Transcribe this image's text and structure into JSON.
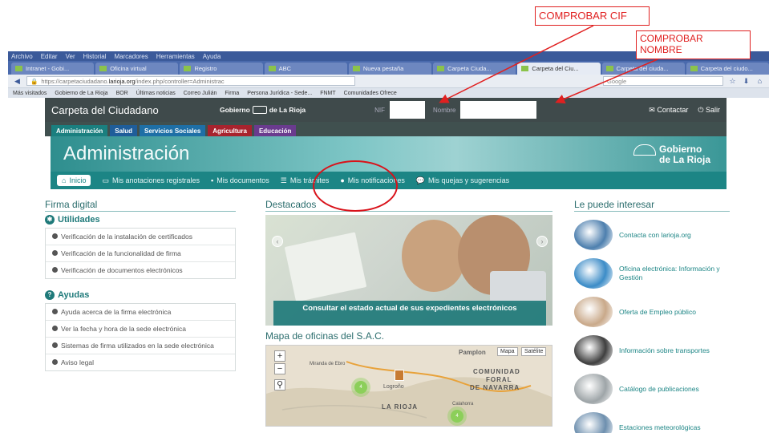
{
  "annotations": {
    "cif": "COMPROBAR CIF",
    "nombre_line1": "COMPROBAR",
    "nombre_line2": "NOMBRE"
  },
  "browser": {
    "menu": [
      "Archivo",
      "Editar",
      "Ver",
      "Historial",
      "Marcadores",
      "Herramientas",
      "Ayuda"
    ],
    "tabs": [
      {
        "label": "Intranet - Gobi..."
      },
      {
        "label": "Oficina virtual"
      },
      {
        "label": "Registro"
      },
      {
        "label": "ABC"
      },
      {
        "label": "Nueva pestaña"
      },
      {
        "label": "Carpeta Ciuda..."
      },
      {
        "label": "Carpeta del Ciu...",
        "active": true
      },
      {
        "label": "Carpeta del ciuda..."
      },
      {
        "label": "Carpeta del ciudo..."
      }
    ],
    "url_prefix": "https://carpetaciudadano.",
    "url_domain": "larioja.org",
    "url_suffix": "/index.php/controller=Administrac",
    "search_placeholder": "Google",
    "bookmarks": [
      "Más visitados",
      "Gobierno de La Rioja",
      "BOR",
      "Últimas noticias",
      "Correo Julián",
      "Firma",
      "Persona Jurídica - Sede...",
      "FNMT",
      "Comunidades Ofrece"
    ]
  },
  "site": {
    "name": "Carpeta del Ciudadano",
    "gov_brand_left": "Gobierno",
    "gov_brand_right": "de La Rioja",
    "nif_label": "NIF",
    "nombre_label": "Nombre",
    "contact": "Contactar",
    "logout": "Salir",
    "sections": [
      {
        "label": "Administración",
        "color": "#1a7f7f"
      },
      {
        "label": "Salud",
        "color": "#1f5d9a"
      },
      {
        "label": "Servicios Sociales",
        "color": "#1e6fa6"
      },
      {
        "label": "Agricultura",
        "color": "#a8232e"
      },
      {
        "label": "Educación",
        "color": "#6a3b8e"
      }
    ],
    "banner_title": "Administración",
    "banner_gov_line1": "Gobierno",
    "banner_gov_line2": "de La Rioja",
    "nav": [
      {
        "label": "Inicio",
        "icon": "home-icon"
      },
      {
        "label": "Mis anotaciones registrales",
        "icon": "laptop-icon"
      },
      {
        "label": "Mis documentos",
        "icon": "folder-icon"
      },
      {
        "label": "Mis trámites",
        "icon": "list-icon"
      },
      {
        "label": "Mis notificaciones",
        "icon": "alert-icon"
      },
      {
        "label": "Mis quejas y sugerencias",
        "icon": "chat-icon"
      }
    ]
  },
  "left": {
    "title": "Firma digital",
    "utilidades_title": "Utilidades",
    "utilidades": [
      "Verificación de la instalación de certificados",
      "Verificación de la funcionalidad de firma",
      "Verificación de documentos electrónicos"
    ],
    "ayudas_title": "Ayudas",
    "ayudas": [
      "Ayuda acerca de la firma electrónica",
      "Ver la fecha y hora de la sede electrónica",
      "Sistemas de firma utilizados en la sede electrónica",
      "Aviso legal"
    ]
  },
  "center": {
    "title": "Destacados",
    "caption": "Consultar el estado actual de sus expedientes electrónicos",
    "map_title": "Mapa de oficinas del S.A.C.",
    "map_buttons": [
      "Mapa",
      "Satélite"
    ],
    "map_labels": [
      "Pamplon",
      "COMUNIDAD",
      "FORAL",
      "DE NAVARRA",
      "LA RIOJA",
      "Logroño",
      "Miranda de Ebro",
      "Calahorra"
    ],
    "clusters": [
      "4",
      "4"
    ]
  },
  "right": {
    "title": "Le puede interesar",
    "items": [
      {
        "label": "Contacta con larioja.org",
        "color": "#4d7fae"
      },
      {
        "label": "Oficina electrónica: Información y Gestión",
        "color": "#3c8cc7"
      },
      {
        "label": "Oferta de Empleo público",
        "color": "#c9a98a"
      },
      {
        "label": "Información sobre transportes",
        "color": "#3f3f3f"
      },
      {
        "label": "Catálogo de publicaciones",
        "color": "#9ea5a8"
      },
      {
        "label": "Estaciones meteorológicas",
        "color": "#6d8fae"
      }
    ]
  }
}
